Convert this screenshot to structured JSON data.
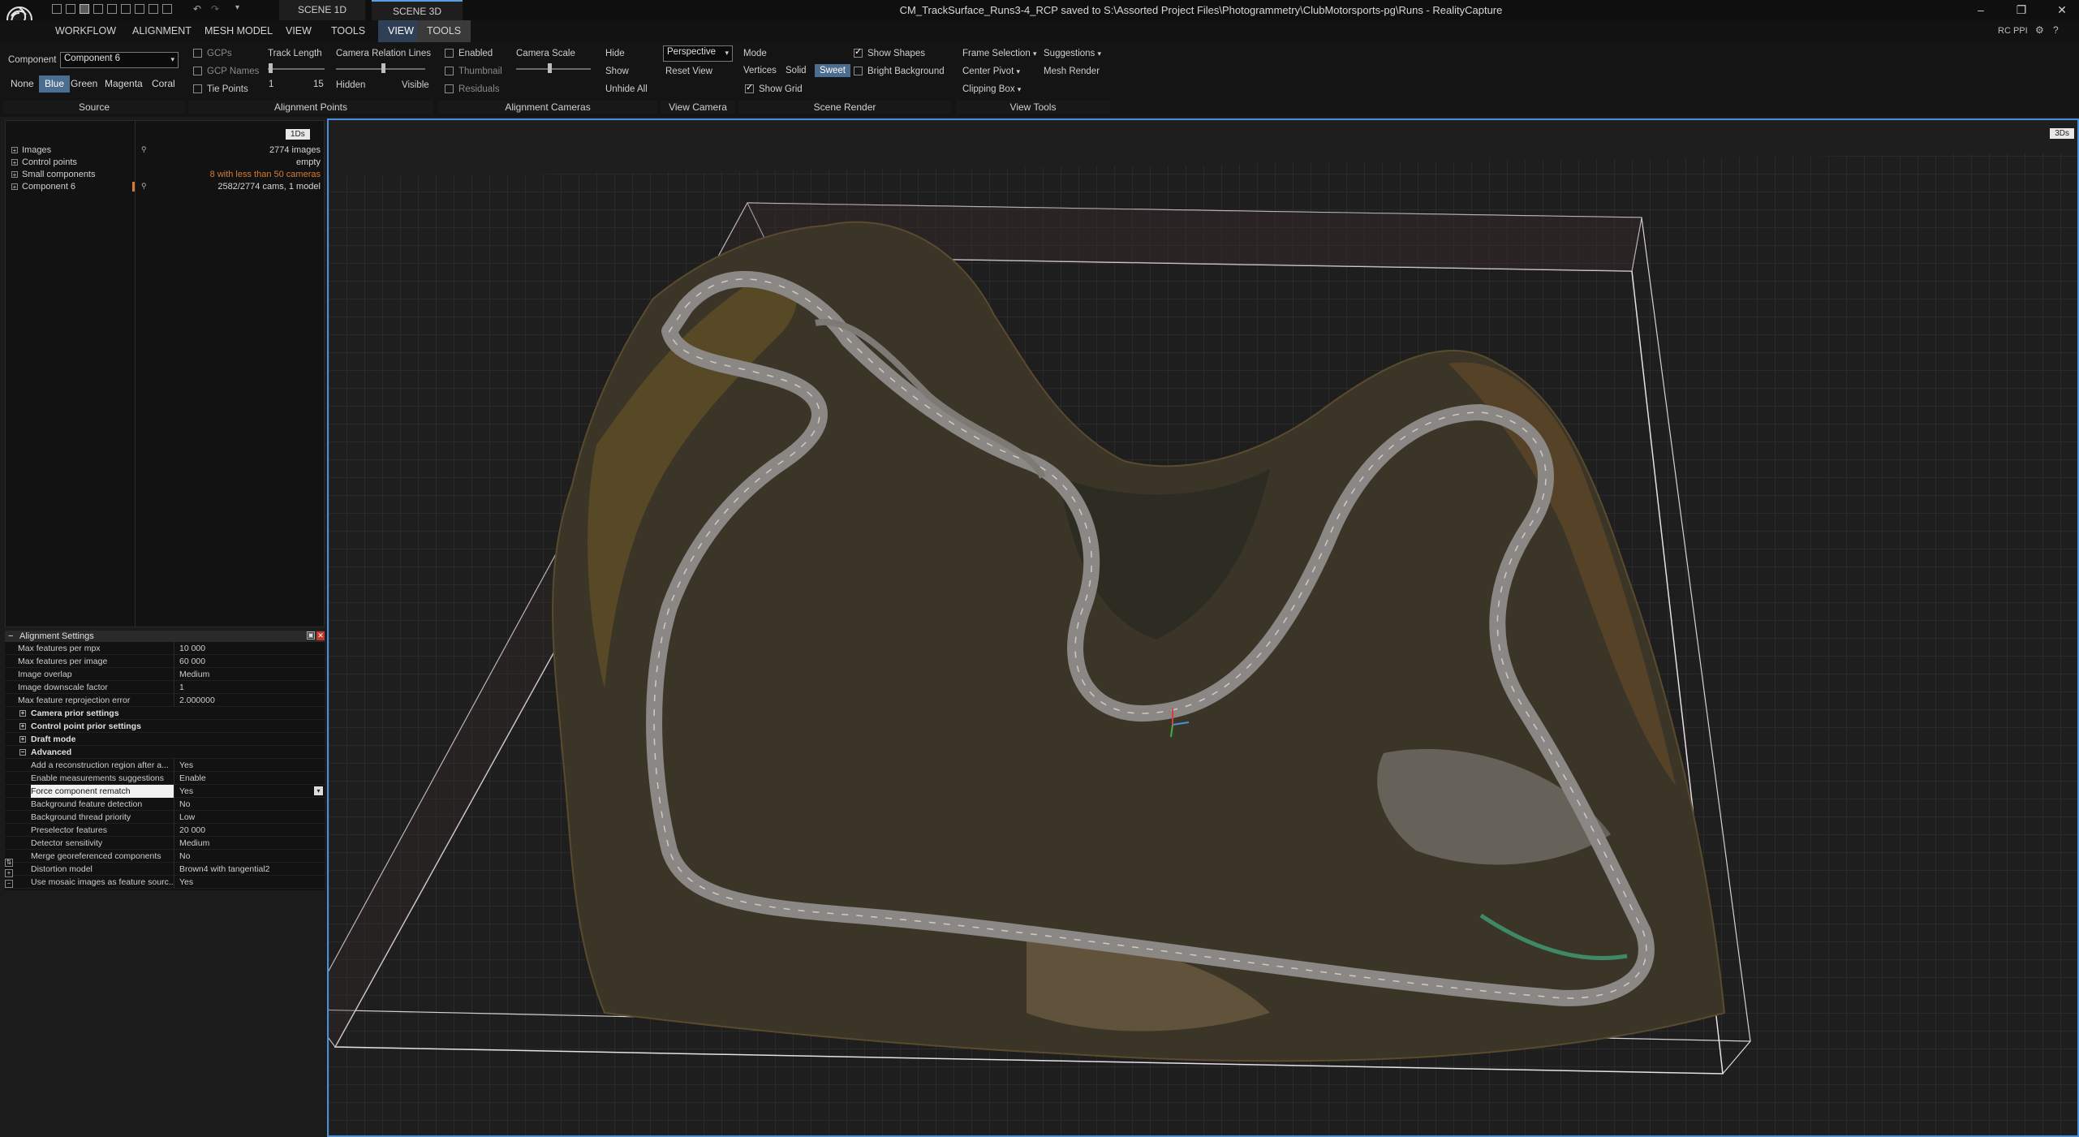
{
  "app": {
    "window_title": "CM_TrackSurface_Runs3-4_RCP saved to S:\\Assorted Project Files\\Photogrammetry\\ClubMotorsports-pg\\Runs - RealityCapture",
    "scene_tabs": [
      "SCENE 1D",
      "SCENE 3D"
    ],
    "rc_ppi": "RC PPI"
  },
  "menu": [
    "WORKFLOW",
    "ALIGNMENT",
    "MESH MODEL",
    "VIEW",
    "TOOLS",
    "VIEW",
    "TOOLS"
  ],
  "ribbon": {
    "source": {
      "component_label": "Component",
      "component_value": "Component 6",
      "colors": [
        "None",
        "Blue",
        "Green",
        "Magenta",
        "Coral"
      ],
      "selected_color": "Blue",
      "group": "Source"
    },
    "alignment_points": {
      "gcps": "GCPs",
      "gcp_names": "GCP Names",
      "tie_points": "Tie Points",
      "track_length": "Track Length",
      "track_min": "1",
      "track_max": "15",
      "camera_relation_lines": "Camera Relation Lines",
      "hidden": "Hidden",
      "visible": "Visible",
      "group": "Alignment Points"
    },
    "alignment_cameras": {
      "enabled": "Enabled",
      "thumbnail": "Thumbnail",
      "residuals": "Residuals",
      "camera_scale": "Camera Scale",
      "hide": "Hide",
      "show": "Show",
      "unhide_all": "Unhide All",
      "group": "Alignment Cameras"
    },
    "view_camera": {
      "projection": "Perspective",
      "reset_view": "Reset View",
      "group": "View Camera"
    },
    "scene_render": {
      "mode": "Mode",
      "vertices": "Vertices",
      "solid": "Solid",
      "sweet": "Sweet",
      "show_shapes": "Show Shapes",
      "bright_background": "Bright Background",
      "show_grid": "Show Grid",
      "group": "Scene Render"
    },
    "view_tools": {
      "frame_selection": "Frame Selection",
      "suggestions": "Suggestions",
      "center_pivot": "Center Pivot",
      "mesh_render": "Mesh Render",
      "clipping_box": "Clipping Box",
      "group": "View Tools"
    }
  },
  "tree": {
    "badge": "1Ds",
    "items": [
      {
        "label": "Images",
        "value": "2774 images"
      },
      {
        "label": "Control points",
        "value": "empty"
      },
      {
        "label": "Small components",
        "value": "8 with less than 50 cameras"
      },
      {
        "label": "Component 6",
        "value": "2582/2774 cams, 1 model"
      }
    ]
  },
  "settings": {
    "title": "Alignment Settings",
    "rows": [
      {
        "k": "Max features per mpx",
        "v": "10 000"
      },
      {
        "k": "Max features per image",
        "v": "60 000"
      },
      {
        "k": "Image overlap",
        "v": "Medium"
      },
      {
        "k": "Image downscale factor",
        "v": "1"
      },
      {
        "k": "Max feature reprojection error",
        "v": "2.000000"
      }
    ],
    "groups": [
      "Camera prior settings",
      "Control point prior settings",
      "Draft mode",
      "Advanced"
    ],
    "advanced": [
      {
        "k": "Add a reconstruction region after a...",
        "v": "Yes"
      },
      {
        "k": "Enable measurements suggestions",
        "v": "Enable"
      },
      {
        "k": "Force component rematch",
        "v": "Yes"
      },
      {
        "k": "Background feature detection",
        "v": "No"
      },
      {
        "k": "Background thread priority",
        "v": "Low"
      },
      {
        "k": "Preselector features",
        "v": "20 000"
      },
      {
        "k": "Detector sensitivity",
        "v": "Medium"
      },
      {
        "k": "Merge georeferenced components",
        "v": "No"
      },
      {
        "k": "Distortion model",
        "v": "Brown4 with tangential2"
      },
      {
        "k": "Use mosaic images as feature sourc...",
        "v": "Yes"
      }
    ]
  },
  "viewport": {
    "badge": "3Ds"
  },
  "colors": {
    "accent": "#4a90d9",
    "selected_button": "#4b6d8f",
    "warning": "#d47c35"
  }
}
